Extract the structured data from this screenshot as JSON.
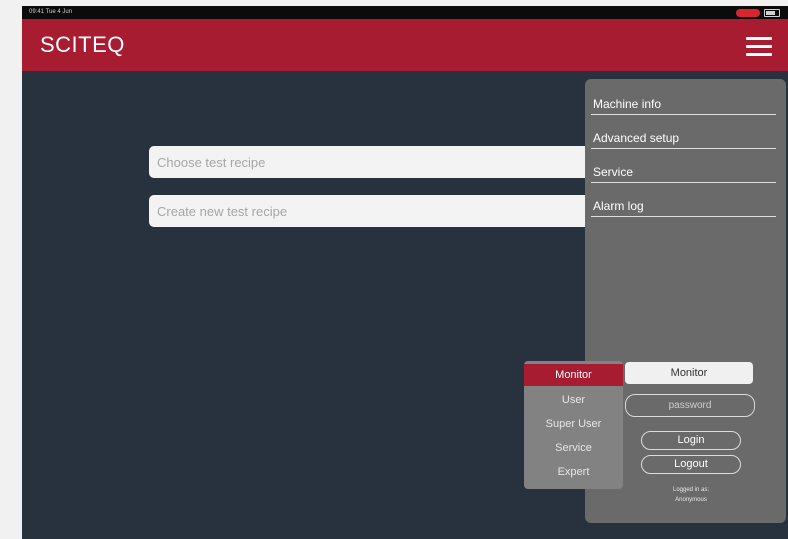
{
  "status_bar": {
    "time": "09:41 Tue 4 Jun"
  },
  "app": {
    "logo": "SCITEQ",
    "menu_icon": "hamburger-menu-icon"
  },
  "main": {
    "choose_placeholder": "Choose test recipe",
    "create_placeholder": "Create new test recipe"
  },
  "menu": {
    "items": [
      {
        "label": "Machine info"
      },
      {
        "label": "Advanced setup"
      },
      {
        "label": "Service"
      },
      {
        "label": "Alarm log"
      }
    ]
  },
  "login": {
    "role": "Monitor",
    "password_placeholder": "password",
    "login_label": "Login",
    "logout_label": "Logout",
    "logged_in_label": "Logged in as:",
    "logged_in_user": "Anonymous"
  },
  "roles": {
    "items": [
      {
        "label": "Monitor",
        "selected": true
      },
      {
        "label": "User"
      },
      {
        "label": "Super User"
      },
      {
        "label": "Service"
      },
      {
        "label": "Expert"
      }
    ]
  },
  "colors": {
    "brand": "#a71c31",
    "background": "#27323e",
    "menu_panel": "#6a6a6a"
  }
}
